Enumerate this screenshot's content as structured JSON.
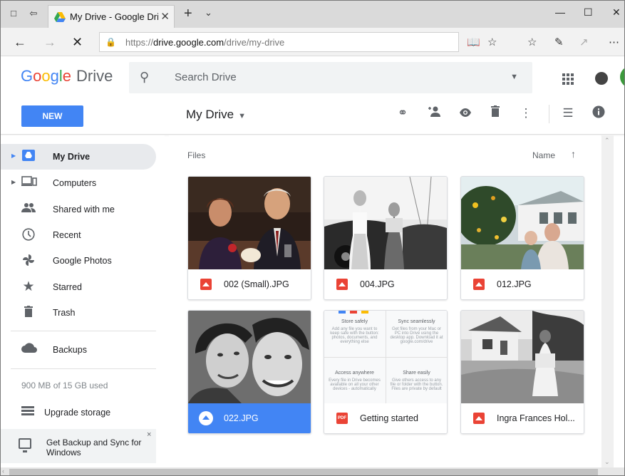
{
  "browser": {
    "tab_title": "My Drive - Google Drive",
    "tab_close": "✕",
    "new_tab": "+",
    "url_prefix": "https://",
    "url_host": "drive.google.com",
    "url_path": "/drive/my-drive"
  },
  "drive": {
    "logo_letters": [
      "G",
      "o",
      "o",
      "g",
      "l",
      "e"
    ],
    "product": "Drive",
    "search_placeholder": "Search Drive",
    "new_button": "NEW",
    "location": "My Drive",
    "colors": {
      "blue": "#4285f4",
      "red": "#ea4335",
      "yellow": "#fbbc05",
      "green": "#34a853",
      "selected_bg": "#e8eaed"
    }
  },
  "sidebar": {
    "items": [
      {
        "label": "My Drive",
        "icon": "drive-icon"
      },
      {
        "label": "Computers",
        "icon": "computers-icon"
      },
      {
        "label": "Shared with me",
        "icon": "shared-icon"
      },
      {
        "label": "Recent",
        "icon": "clock-icon"
      },
      {
        "label": "Google Photos",
        "icon": "pinwheel-icon"
      },
      {
        "label": "Starred",
        "icon": "star-icon"
      },
      {
        "label": "Trash",
        "icon": "trash-icon"
      },
      {
        "label": "Backups",
        "icon": "cloud-icon"
      }
    ],
    "storage": "900 MB of 15 GB used",
    "upgrade": "Upgrade storage",
    "backup_promo": "Get Backup and Sync for Windows",
    "backup_close": "×"
  },
  "main": {
    "section": "Files",
    "sort_label": "Name",
    "sort_arrow": "↑",
    "files": [
      {
        "name": "002 (Small).JPG",
        "type": "image"
      },
      {
        "name": "004.JPG",
        "type": "image"
      },
      {
        "name": "012.JPG",
        "type": "image"
      },
      {
        "name": "022.JPG",
        "type": "image",
        "selected": true
      },
      {
        "name": "Getting started",
        "type": "pdf"
      },
      {
        "name": "Ingra Frances Hol...",
        "type": "image"
      }
    ],
    "pdf_badge": "PDF",
    "getting_started": {
      "q1_title": "Store safely",
      "q1_text": "Add any file you want to keep safe with the button: photos, documents, and everything else",
      "q2_title": "Sync seamlessly",
      "q2_text": "Get files from your Mac or PC into Drive using the desktop app. Download it at google.com/drive",
      "q3_title": "Access anywhere",
      "q3_text": "Every file in Drive becomes available on all your other devices - automatically",
      "q4_title": "Share easily",
      "q4_text": "Give others access to any file or folder with the button. Files are private by default"
    }
  }
}
